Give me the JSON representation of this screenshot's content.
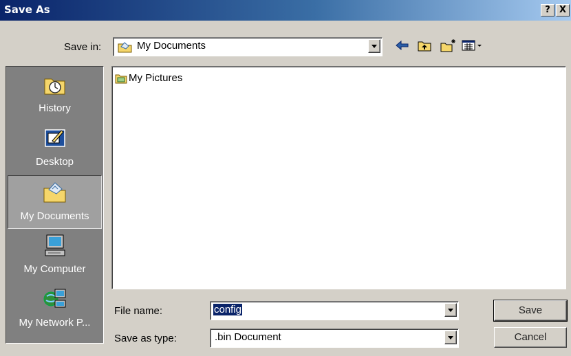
{
  "window": {
    "title": "Save As",
    "help_button": "?",
    "close_button": "X"
  },
  "save_in": {
    "label": "Save in:",
    "value": "My Documents",
    "icon": "my-documents-icon"
  },
  "toolbar": {
    "back_icon": "back-arrow-icon",
    "up_icon": "up-one-level-icon",
    "new_folder_icon": "new-folder-icon",
    "view_menu_icon": "view-menu-icon"
  },
  "places": [
    {
      "label": "History",
      "icon": "history-icon"
    },
    {
      "label": "Desktop",
      "icon": "desktop-icon"
    },
    {
      "label": "My Documents",
      "icon": "my-documents-icon"
    },
    {
      "label": "My Computer",
      "icon": "my-computer-icon"
    },
    {
      "label": "My Network P...",
      "icon": "my-network-places-icon"
    }
  ],
  "files": [
    {
      "name": "My Pictures",
      "icon": "folder-pictures-icon"
    }
  ],
  "file_name": {
    "label": "File name:",
    "value": "config"
  },
  "save_as_type": {
    "label": "Save as type:",
    "value": ".bin Document"
  },
  "buttons": {
    "save": "Save",
    "cancel": "Cancel"
  },
  "colors": {
    "titlebar_start": "#0a246a",
    "titlebar_end": "#a6caf0",
    "face": "#d4d0c8",
    "places_bar": "#808080",
    "selection": "#0a246a"
  }
}
